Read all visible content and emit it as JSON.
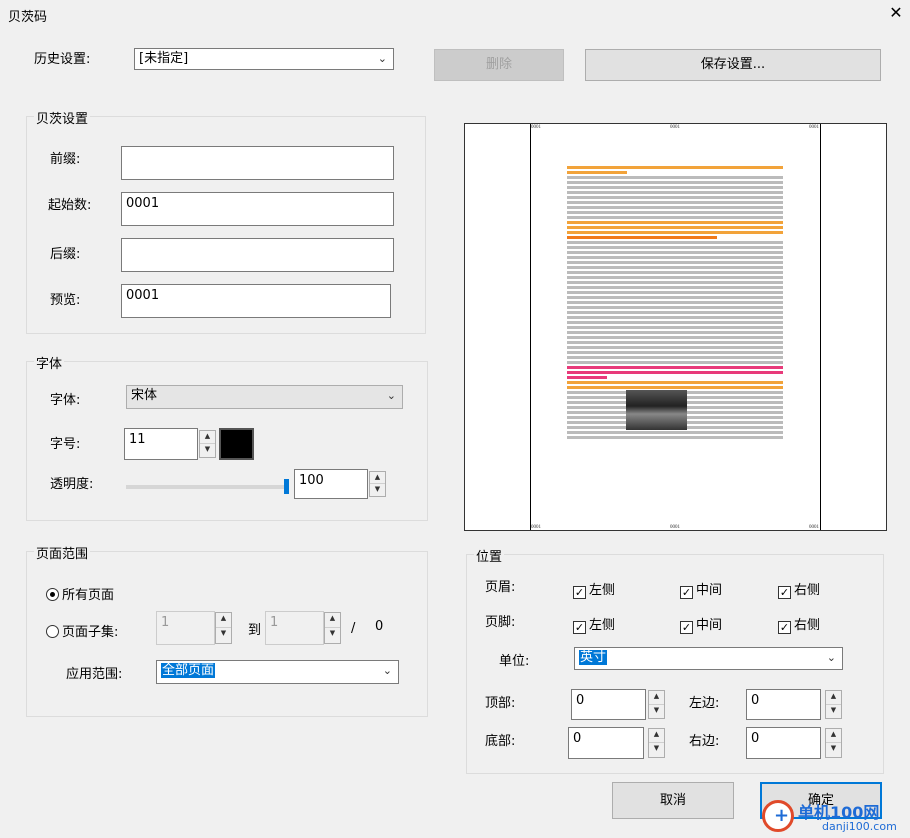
{
  "window": {
    "title": "贝茨码",
    "close_glyph": "✕"
  },
  "history": {
    "label": "历史设置:",
    "value": "[未指定]",
    "delete_label": "删除",
    "save_label": "保存设置..."
  },
  "bates": {
    "title": "贝茨设置",
    "prefix_label": "前缀:",
    "prefix_value": "",
    "start_label": "起始数:",
    "start_value": "0001",
    "suffix_label": "后缀:",
    "suffix_value": "",
    "preview_label": "预览:",
    "preview_value": "0001"
  },
  "font": {
    "title": "字体",
    "font_label": "字体:",
    "font_value": "宋体",
    "size_label": "字号:",
    "size_value": "11",
    "color": "#000000",
    "opacity_label": "透明度:",
    "opacity_value": "100"
  },
  "range": {
    "title": "页面范围",
    "all_pages_label": "所有页面",
    "subset_label": "页面子集:",
    "from_value": "1",
    "to_label": "到",
    "to_value": "1",
    "slash": "/",
    "total": "0",
    "apply_label": "应用范围:",
    "apply_value": "全部页面"
  },
  "position": {
    "title": "位置",
    "header_label": "页眉:",
    "footer_label": "页脚:",
    "left_label": "左侧",
    "center_label": "中间",
    "right_label": "右侧",
    "unit_label": "单位:",
    "unit_value": "英寸",
    "top_label": "顶部:",
    "top_value": "0",
    "bottom_label": "底部:",
    "bottom_value": "0",
    "leftm_label": "左边:",
    "leftm_value": "0",
    "rightm_label": "右边:",
    "rightm_value": "0"
  },
  "preview_page": {
    "header_left": "0001",
    "header_center": "0001",
    "header_right": "0001",
    "footer_left": "0001",
    "footer_center": "0001",
    "footer_right": "0001"
  },
  "buttons": {
    "cancel_label": "取消",
    "ok_label": "确定"
  },
  "watermark": {
    "text": "单机100网",
    "url": "danji100.com"
  }
}
